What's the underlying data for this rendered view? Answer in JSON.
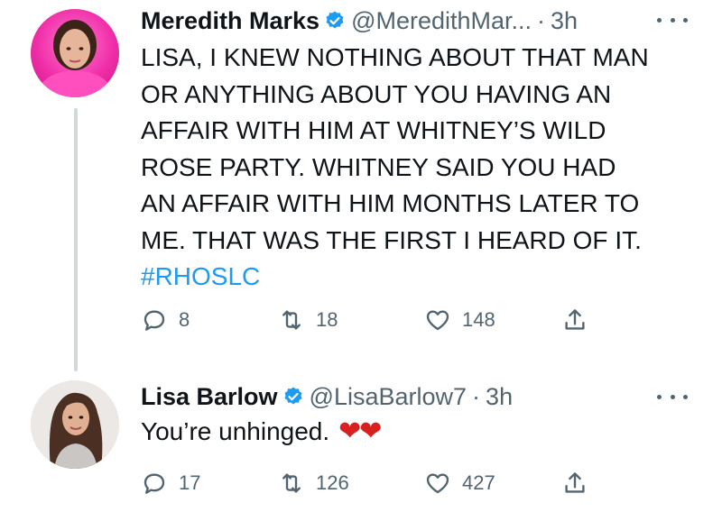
{
  "tweets": [
    {
      "display_name": "Meredith Marks",
      "handle": "@MeredithMar...",
      "separator": "·",
      "time": "3h",
      "body_lines": [
        "LISA, I KNEW NOTHING ABOUT THAT MAN",
        "OR ANYTHING ABOUT YOU HAVING AN",
        "AFFAIR WITH HIM AT WHITNEY’S  WILD",
        "ROSE PARTY.  WHITNEY SAID YOU HAD",
        "AN AFFAIR WITH HIM MONTHS LATER TO",
        "ME. THAT WAS THE FIRST I HEARD OF IT."
      ],
      "hashtag": "#RHOSLC",
      "replies": "8",
      "retweets": "18",
      "likes": "148"
    },
    {
      "display_name": "Lisa Barlow",
      "handle": "@LisaBarlow7",
      "separator": "·",
      "time": "3h",
      "body": "You’re unhinged.",
      "emoji": "❤❤",
      "replies": "17",
      "retweets": "126",
      "likes": "427"
    }
  ],
  "icons": {
    "verified": "verified-badge-icon",
    "reply": "reply-icon",
    "retweet": "retweet-icon",
    "like": "heart-icon",
    "share": "share-icon",
    "more": "more-icon"
  },
  "colors": {
    "accent": "#1d9bf0",
    "text": "#0f1419",
    "secondary": "#536471",
    "heart_emoji": "#d8201f",
    "avatar_1_bg": "#f02ea8"
  }
}
